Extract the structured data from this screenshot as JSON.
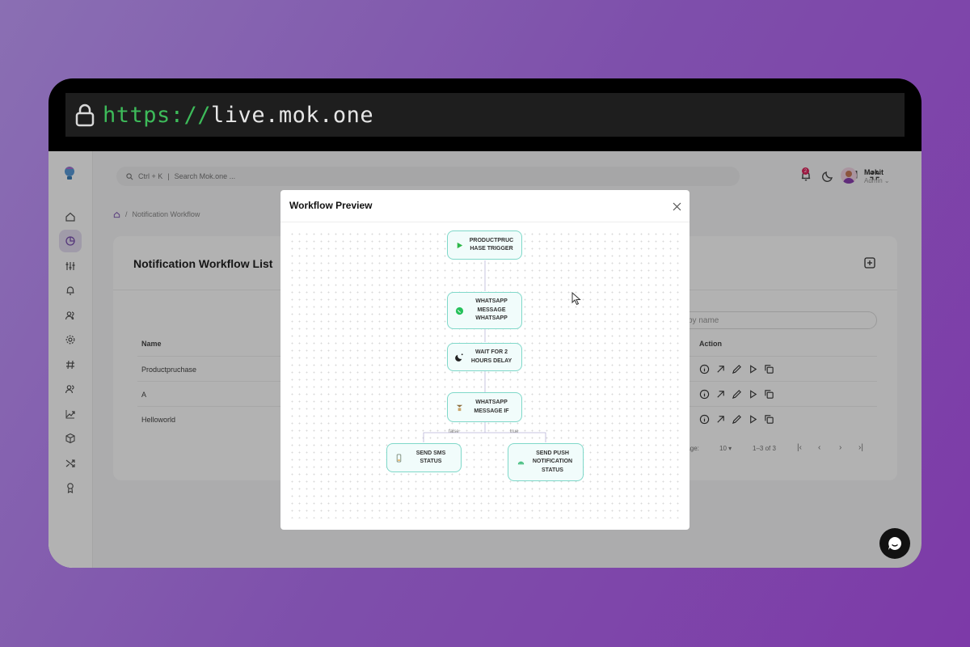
{
  "browser": {
    "url_scheme": "https://",
    "url_host": "live.mok.one"
  },
  "topbar": {
    "search_shortcut": "Ctrl + K",
    "search_placeholder": "Search Mok.one ...",
    "notification_count": "2",
    "user_name": "Mohit",
    "user_role": "Admin"
  },
  "breadcrumb": {
    "current": "Notification Workflow"
  },
  "page": {
    "title": "Notification Workflow List",
    "search_placeholder": "by name",
    "columns": {
      "name": "Name",
      "action": "Action"
    },
    "rows": [
      {
        "name": "Productpruchase"
      },
      {
        "name": "A"
      },
      {
        "name": "Helloworld"
      }
    ],
    "pager": {
      "rows_label": "r page:",
      "rows_value": "10",
      "range": "1–3 of 3"
    }
  },
  "modal": {
    "title": "Workflow Preview",
    "nodes": {
      "trigger": "PRODUCTPRUC HASE TRIGGER",
      "whatsapp": "WHATSAPP MESSAGE WHATSAPP",
      "wait": "WAIT FOR 2 HOURS DELAY",
      "condition": "WHATSAPP MESSAGE IF",
      "sms": "SEND SMS STATUS",
      "push": "SEND PUSH NOTIFICATION STATUS"
    },
    "edges": {
      "false_label": "false",
      "true_label": "true"
    }
  },
  "colors": {
    "accent": "#7fd8c9",
    "node_bg": "#f1fcfb",
    "active_sidebar": "#e6def3",
    "url_scheme": "#3dbb5a"
  }
}
